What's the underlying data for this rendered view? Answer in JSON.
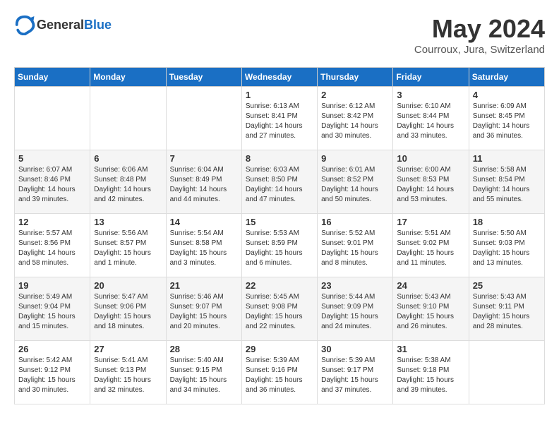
{
  "header": {
    "logo_general": "General",
    "logo_blue": "Blue",
    "month_title": "May 2024",
    "location": "Courroux, Jura, Switzerland"
  },
  "calendar": {
    "days_of_week": [
      "Sunday",
      "Monday",
      "Tuesday",
      "Wednesday",
      "Thursday",
      "Friday",
      "Saturday"
    ],
    "weeks": [
      [
        {
          "day": "",
          "info": ""
        },
        {
          "day": "",
          "info": ""
        },
        {
          "day": "",
          "info": ""
        },
        {
          "day": "1",
          "info": "Sunrise: 6:13 AM\nSunset: 8:41 PM\nDaylight: 14 hours\nand 27 minutes."
        },
        {
          "day": "2",
          "info": "Sunrise: 6:12 AM\nSunset: 8:42 PM\nDaylight: 14 hours\nand 30 minutes."
        },
        {
          "day": "3",
          "info": "Sunrise: 6:10 AM\nSunset: 8:44 PM\nDaylight: 14 hours\nand 33 minutes."
        },
        {
          "day": "4",
          "info": "Sunrise: 6:09 AM\nSunset: 8:45 PM\nDaylight: 14 hours\nand 36 minutes."
        }
      ],
      [
        {
          "day": "5",
          "info": "Sunrise: 6:07 AM\nSunset: 8:46 PM\nDaylight: 14 hours\nand 39 minutes."
        },
        {
          "day": "6",
          "info": "Sunrise: 6:06 AM\nSunset: 8:48 PM\nDaylight: 14 hours\nand 42 minutes."
        },
        {
          "day": "7",
          "info": "Sunrise: 6:04 AM\nSunset: 8:49 PM\nDaylight: 14 hours\nand 44 minutes."
        },
        {
          "day": "8",
          "info": "Sunrise: 6:03 AM\nSunset: 8:50 PM\nDaylight: 14 hours\nand 47 minutes."
        },
        {
          "day": "9",
          "info": "Sunrise: 6:01 AM\nSunset: 8:52 PM\nDaylight: 14 hours\nand 50 minutes."
        },
        {
          "day": "10",
          "info": "Sunrise: 6:00 AM\nSunset: 8:53 PM\nDaylight: 14 hours\nand 53 minutes."
        },
        {
          "day": "11",
          "info": "Sunrise: 5:58 AM\nSunset: 8:54 PM\nDaylight: 14 hours\nand 55 minutes."
        }
      ],
      [
        {
          "day": "12",
          "info": "Sunrise: 5:57 AM\nSunset: 8:56 PM\nDaylight: 14 hours\nand 58 minutes."
        },
        {
          "day": "13",
          "info": "Sunrise: 5:56 AM\nSunset: 8:57 PM\nDaylight: 15 hours\nand 1 minute."
        },
        {
          "day": "14",
          "info": "Sunrise: 5:54 AM\nSunset: 8:58 PM\nDaylight: 15 hours\nand 3 minutes."
        },
        {
          "day": "15",
          "info": "Sunrise: 5:53 AM\nSunset: 8:59 PM\nDaylight: 15 hours\nand 6 minutes."
        },
        {
          "day": "16",
          "info": "Sunrise: 5:52 AM\nSunset: 9:01 PM\nDaylight: 15 hours\nand 8 minutes."
        },
        {
          "day": "17",
          "info": "Sunrise: 5:51 AM\nSunset: 9:02 PM\nDaylight: 15 hours\nand 11 minutes."
        },
        {
          "day": "18",
          "info": "Sunrise: 5:50 AM\nSunset: 9:03 PM\nDaylight: 15 hours\nand 13 minutes."
        }
      ],
      [
        {
          "day": "19",
          "info": "Sunrise: 5:49 AM\nSunset: 9:04 PM\nDaylight: 15 hours\nand 15 minutes."
        },
        {
          "day": "20",
          "info": "Sunrise: 5:47 AM\nSunset: 9:06 PM\nDaylight: 15 hours\nand 18 minutes."
        },
        {
          "day": "21",
          "info": "Sunrise: 5:46 AM\nSunset: 9:07 PM\nDaylight: 15 hours\nand 20 minutes."
        },
        {
          "day": "22",
          "info": "Sunrise: 5:45 AM\nSunset: 9:08 PM\nDaylight: 15 hours\nand 22 minutes."
        },
        {
          "day": "23",
          "info": "Sunrise: 5:44 AM\nSunset: 9:09 PM\nDaylight: 15 hours\nand 24 minutes."
        },
        {
          "day": "24",
          "info": "Sunrise: 5:43 AM\nSunset: 9:10 PM\nDaylight: 15 hours\nand 26 minutes."
        },
        {
          "day": "25",
          "info": "Sunrise: 5:43 AM\nSunset: 9:11 PM\nDaylight: 15 hours\nand 28 minutes."
        }
      ],
      [
        {
          "day": "26",
          "info": "Sunrise: 5:42 AM\nSunset: 9:12 PM\nDaylight: 15 hours\nand 30 minutes."
        },
        {
          "day": "27",
          "info": "Sunrise: 5:41 AM\nSunset: 9:13 PM\nDaylight: 15 hours\nand 32 minutes."
        },
        {
          "day": "28",
          "info": "Sunrise: 5:40 AM\nSunset: 9:15 PM\nDaylight: 15 hours\nand 34 minutes."
        },
        {
          "day": "29",
          "info": "Sunrise: 5:39 AM\nSunset: 9:16 PM\nDaylight: 15 hours\nand 36 minutes."
        },
        {
          "day": "30",
          "info": "Sunrise: 5:39 AM\nSunset: 9:17 PM\nDaylight: 15 hours\nand 37 minutes."
        },
        {
          "day": "31",
          "info": "Sunrise: 5:38 AM\nSunset: 9:18 PM\nDaylight: 15 hours\nand 39 minutes."
        },
        {
          "day": "",
          "info": ""
        }
      ]
    ]
  }
}
